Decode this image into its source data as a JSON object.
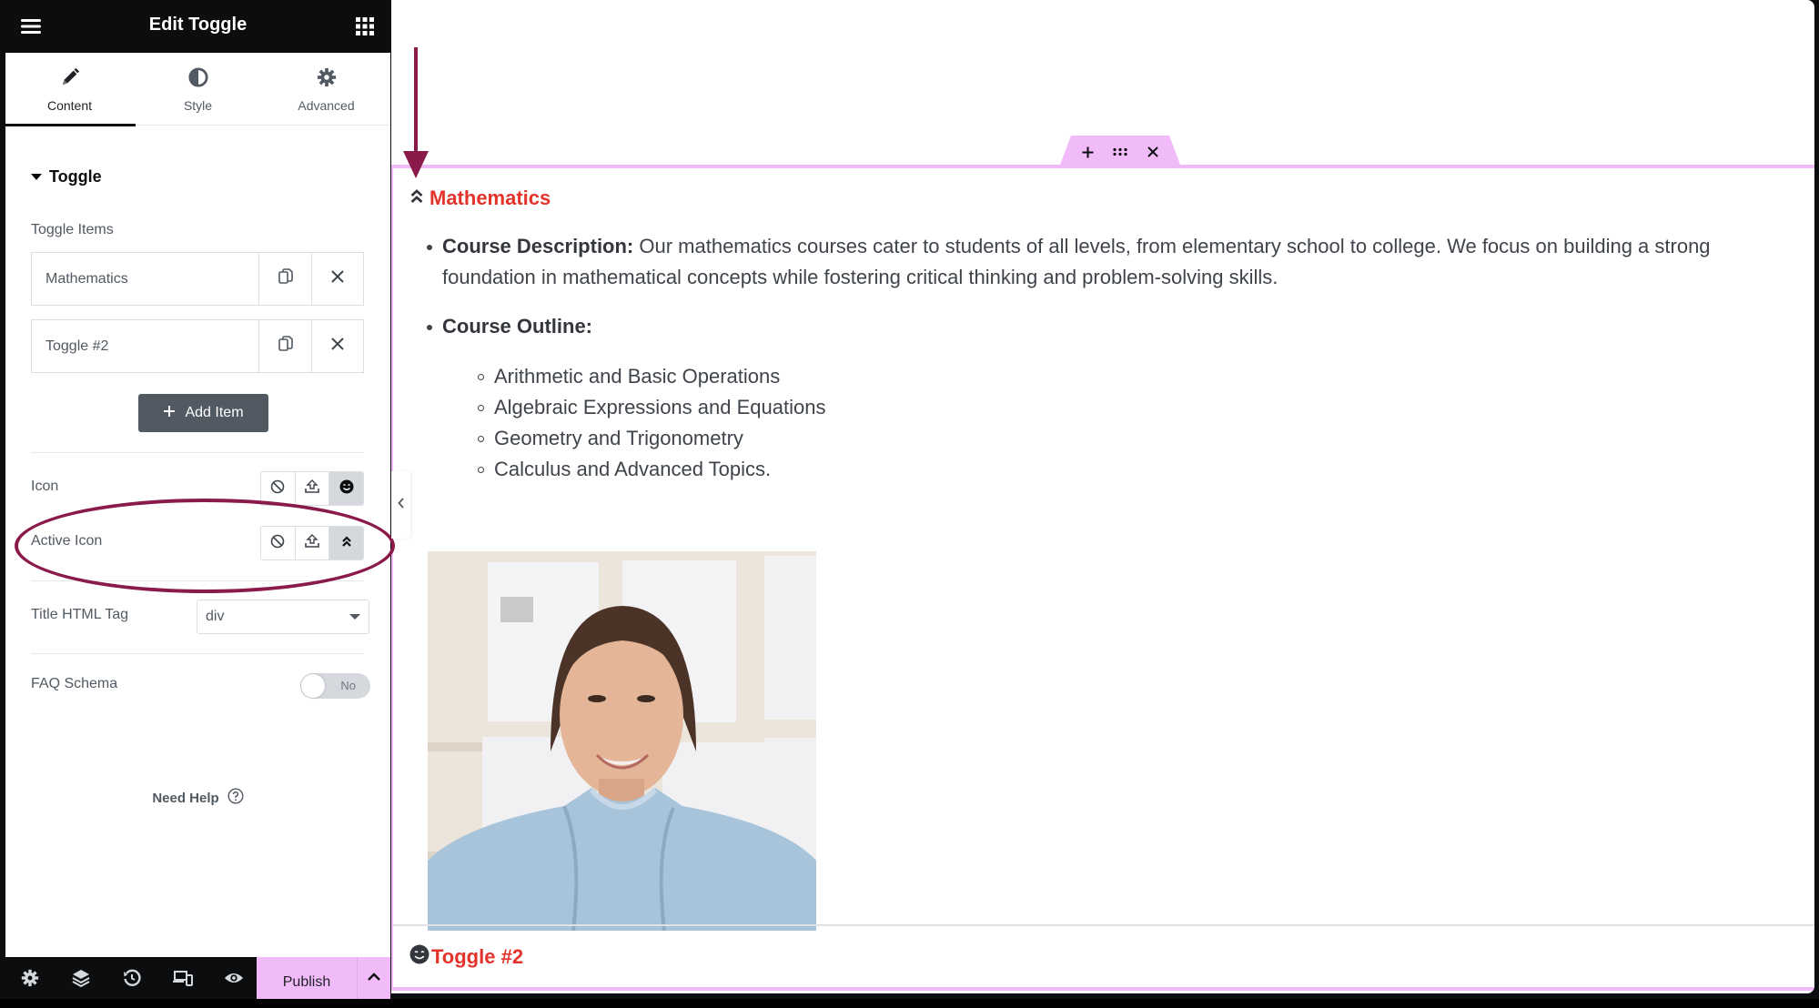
{
  "panel": {
    "title": "Edit Toggle",
    "header_icons": {
      "left": "hamburger-menu-icon",
      "right": "widgets-grid-icon"
    },
    "tabs": [
      {
        "label": "Content",
        "icon": "pencil-icon",
        "active": true
      },
      {
        "label": "Style",
        "icon": "half-circle-contrast-icon",
        "active": false
      },
      {
        "label": "Advanced",
        "icon": "gear-icon",
        "active": false
      }
    ],
    "section": {
      "title": "Toggle",
      "expanded": true
    },
    "toggle_items_label": "Toggle Items",
    "items": [
      {
        "title": "Mathematics",
        "duplicate_icon": "copy-icon",
        "remove_icon": "close-icon"
      },
      {
        "title": "Toggle #2",
        "duplicate_icon": "copy-icon",
        "remove_icon": "close-icon"
      }
    ],
    "add_item_label": "Add Item",
    "icon_control": {
      "label": "Icon",
      "options": [
        "none-icon",
        "upload-icon",
        "smiley-icon"
      ],
      "selected": "smiley-icon"
    },
    "active_icon_control": {
      "label": "Active Icon",
      "options": [
        "none-icon",
        "upload-icon",
        "angle-double-up-icon"
      ],
      "selected": "angle-double-up-icon"
    },
    "title_html_tag": {
      "label": "Title HTML Tag",
      "value": "div"
    },
    "faq_schema": {
      "label": "FAQ Schema",
      "state_label": "No",
      "enabled": false
    },
    "need_help_label": "Need Help",
    "footer": {
      "icons": [
        "settings-gear-icon",
        "layers-icon",
        "history-icon",
        "responsive-devices-icon",
        "preview-eye-icon"
      ],
      "publish_label": "Publish",
      "accent_color": "#f1bbf9"
    }
  },
  "canvas": {
    "widget_toolbar": [
      "add-icon",
      "drag-handle-icon",
      "close-icon"
    ],
    "toggles": [
      {
        "title": "Mathematics",
        "icon": "angle-double-up-icon",
        "open": true,
        "content": {
          "description_label": "Course Description:",
          "description_text": " Our mathematics courses cater to students of all levels, from elementary school to college. We focus on building a strong foundation in mathematical concepts while fostering critical thinking and problem-solving skills.",
          "outline_label": "Course Outline:",
          "outline_items": [
            "Arithmetic and Basic Operations",
            "Algebraic Expressions and Equations",
            "Geometry and Trigonometry",
            "Calculus and Advanced Topics."
          ],
          "image": "portrait-photo-smiling-woman"
        }
      },
      {
        "title": "Toggle #2",
        "icon": "smiley-icon",
        "open": false
      }
    ],
    "title_color": "#e4332a",
    "editing_outline_color": "#f1bbf9"
  },
  "annotations": {
    "color": "#891a4a",
    "items": [
      "arrow-pointing-to-active-icon",
      "ellipse-around-active-icon-control"
    ]
  }
}
